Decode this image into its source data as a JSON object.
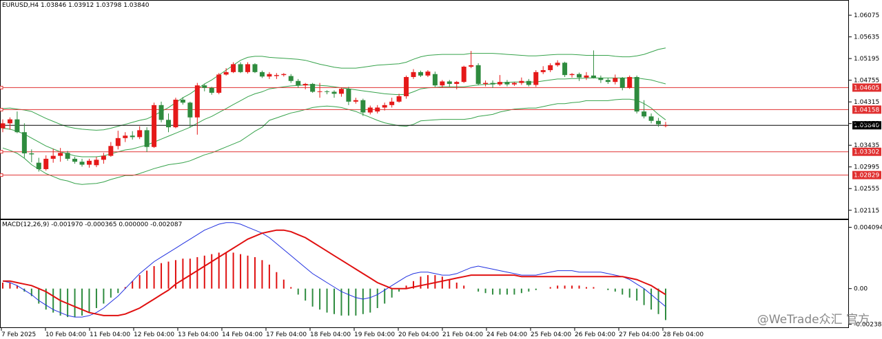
{
  "header": {
    "symbol_info": "EURUSD,H4  1.03846 1.03912 1.03798 1.03840",
    "macd_info": "MACD(12,26,9) -0.001970 -0.000365 0.000000 -0.002087"
  },
  "watermark": "@WeTrade众汇 官方",
  "colors": {
    "bull": "#e51919",
    "bear": "#2e8b3e",
    "band": "#35a24a",
    "level": "#e03030",
    "macd_signal": "#e01010",
    "macd_main": "#2030e0",
    "price_line": "#000000"
  },
  "chart_data": [
    {
      "type": "candlestick",
      "title": "EURUSD,H4",
      "y_axis_ticks": [
        "1.06075",
        "1.05635",
        "1.05195",
        "1.04755",
        "1.04315",
        "1.03875",
        "1.03435",
        "1.02995",
        "1.02555",
        "1.02115"
      ],
      "ylim": [
        1.02,
        1.063
      ],
      "x_axis_labels": [
        "7 Feb 2025",
        "10 Feb 04:00",
        "11 Feb 04:00",
        "12 Feb 04:00",
        "13 Feb 04:00",
        "14 Feb 04:00",
        "17 Feb 04:00",
        "18 Feb 04:00",
        "19 Feb 04:00",
        "20 Feb 04:00",
        "21 Feb 04:00",
        "24 Feb 04:00",
        "25 Feb 04:00",
        "26 Feb 04:00",
        "27 Feb 04:00",
        "28 Feb 04:00"
      ],
      "current_price": "1.03840",
      "levels": [
        {
          "label": "1.04605",
          "value": 1.04605
        },
        {
          "label": "1.04158",
          "value": 1.04158
        },
        {
          "label": "1.03302",
          "value": 1.03302
        },
        {
          "label": "1.02829",
          "value": 1.02829
        }
      ],
      "candles": [
        [
          1.0378,
          1.0396,
          1.037,
          1.0388
        ],
        [
          1.0388,
          1.04,
          1.0375,
          1.0396
        ],
        [
          1.0396,
          1.0412,
          1.0368,
          1.037
        ],
        [
          1.037,
          1.0388,
          1.0318,
          1.0327
        ],
        [
          1.0327,
          1.0335,
          1.0309,
          1.0325
        ],
        [
          1.0308,
          1.0318,
          1.029,
          1.0295
        ],
        [
          1.0295,
          1.0323,
          1.0292,
          1.0316
        ],
        [
          1.0316,
          1.0336,
          1.0308,
          1.0322
        ],
        [
          1.0322,
          1.0338,
          1.031,
          1.0328
        ],
        [
          1.0328,
          1.0332,
          1.0312,
          1.0316
        ],
        [
          1.0316,
          1.032,
          1.0306,
          1.031
        ],
        [
          1.031,
          1.0316,
          1.03,
          1.0304
        ],
        [
          1.0304,
          1.0316,
          1.0298,
          1.0312
        ],
        [
          1.0303,
          1.032,
          1.0299,
          1.0314
        ],
        [
          1.0314,
          1.0328,
          1.0306,
          1.0322
        ],
        [
          1.0322,
          1.035,
          1.032,
          1.0342
        ],
        [
          1.0342,
          1.0373,
          1.0335,
          1.0358
        ],
        [
          1.0358,
          1.037,
          1.035,
          1.0363
        ],
        [
          1.0363,
          1.0372,
          1.0355,
          1.036
        ],
        [
          1.036,
          1.0382,
          1.0356,
          1.0374
        ],
        [
          1.0374,
          1.038,
          1.033,
          1.034
        ],
        [
          1.034,
          1.043,
          1.0338,
          1.0425
        ],
        [
          1.0425,
          1.0432,
          1.039,
          1.0395
        ],
        [
          1.0395,
          1.0408,
          1.037,
          1.038
        ],
        [
          1.038,
          1.044,
          1.0378,
          1.0436
        ],
        [
          1.0436,
          1.0441,
          1.0426,
          1.043
        ],
        [
          1.043,
          1.0432,
          1.038,
          1.04
        ],
        [
          1.04,
          1.047,
          1.0365,
          1.0465
        ],
        [
          1.0465,
          1.0468,
          1.0453,
          1.046
        ],
        [
          1.046,
          1.0462,
          1.0446,
          1.045
        ],
        [
          1.045,
          1.049,
          1.0447,
          1.0487
        ],
        [
          1.0487,
          1.05,
          1.0485,
          1.0492
        ],
        [
          1.0492,
          1.0512,
          1.049,
          1.0508
        ],
        [
          1.0508,
          1.0512,
          1.049,
          1.0492
        ],
        [
          1.0492,
          1.0512,
          1.0489,
          1.0508
        ],
        [
          1.0508,
          1.051,
          1.049,
          1.0492
        ],
        [
          1.0492,
          1.0495,
          1.048,
          1.0483
        ],
        [
          1.0483,
          1.0492,
          1.0478,
          1.0488
        ],
        [
          1.0484,
          1.049,
          1.0478,
          1.0486
        ],
        [
          1.0486,
          1.049,
          1.0483,
          1.0488
        ],
        [
          1.0484,
          1.0488,
          1.047,
          1.0474
        ],
        [
          1.0474,
          1.0478,
          1.046,
          1.0465
        ],
        [
          1.0465,
          1.047,
          1.0457,
          1.0468
        ],
        [
          1.0468,
          1.047,
          1.045,
          1.0452
        ],
        [
          1.0452,
          1.047,
          1.044,
          1.0453
        ],
        [
          1.0453,
          1.0455,
          1.0447,
          1.0452
        ],
        [
          1.0452,
          1.0455,
          1.044,
          1.0448
        ],
        [
          1.0448,
          1.046,
          1.0442,
          1.0458
        ],
        [
          1.0458,
          1.0462,
          1.0425,
          1.0432
        ],
        [
          1.0432,
          1.044,
          1.0428,
          1.0435
        ],
        [
          1.0435,
          1.0438,
          1.0403,
          1.041
        ],
        [
          1.041,
          1.0424,
          1.0406,
          1.042
        ],
        [
          1.0412,
          1.0425,
          1.0408,
          1.042
        ],
        [
          1.042,
          1.043,
          1.0414,
          1.0425
        ],
        [
          1.0425,
          1.044,
          1.042,
          1.0432
        ],
        [
          1.0432,
          1.0448,
          1.043,
          1.0443
        ],
        [
          1.0443,
          1.0485,
          1.0438,
          1.0482
        ],
        [
          1.0482,
          1.0498,
          1.0478,
          1.0492
        ],
        [
          1.0492,
          1.0495,
          1.0482,
          1.0485
        ],
        [
          1.0485,
          1.0496,
          1.0482,
          1.0493
        ],
        [
          1.0488,
          1.0493,
          1.0462,
          1.0465
        ],
        [
          1.0465,
          1.0476,
          1.046,
          1.0473
        ],
        [
          1.0473,
          1.0476,
          1.0462,
          1.0468
        ],
        [
          1.0468,
          1.0474,
          1.0457,
          1.0472
        ],
        [
          1.0472,
          1.0505,
          1.047,
          1.0503
        ],
        [
          1.0503,
          1.0535,
          1.05,
          1.0506
        ],
        [
          1.0506,
          1.051,
          1.0465,
          1.0468
        ],
        [
          1.0468,
          1.0475,
          1.0463,
          1.047
        ],
        [
          1.047,
          1.0475,
          1.046,
          1.0467
        ],
        [
          1.0467,
          1.0486,
          1.0464,
          1.0472
        ],
        [
          1.0472,
          1.0476,
          1.0463,
          1.0467
        ],
        [
          1.0467,
          1.0472,
          1.0464,
          1.047
        ],
        [
          1.047,
          1.0481,
          1.0466,
          1.0474
        ],
        [
          1.0474,
          1.0478,
          1.0463,
          1.0466
        ],
        [
          1.0466,
          1.0496,
          1.0462,
          1.0492
        ],
        [
          1.0492,
          1.0504,
          1.0488,
          1.0496
        ],
        [
          1.0496,
          1.051,
          1.0492,
          1.0506
        ],
        [
          1.0506,
          1.0516,
          1.0503,
          1.0511
        ],
        [
          1.0511,
          1.0513,
          1.0482,
          1.0486
        ],
        [
          1.0486,
          1.049,
          1.0481,
          1.0488
        ],
        [
          1.0488,
          1.0491,
          1.0474,
          1.0481
        ],
        [
          1.0481,
          1.0492,
          1.0476,
          1.0485
        ],
        [
          1.0485,
          1.0536,
          1.0479,
          1.048
        ],
        [
          1.048,
          1.0485,
          1.047,
          1.0476
        ],
        [
          1.0476,
          1.048,
          1.0468,
          1.0472
        ],
        [
          1.0472,
          1.0487,
          1.0467,
          1.048
        ],
        [
          1.048,
          1.0482,
          1.0455,
          1.046
        ],
        [
          1.046,
          1.0485,
          1.0458,
          1.0482
        ],
        [
          1.0482,
          1.0485,
          1.0408,
          1.0412
        ],
        [
          1.0412,
          1.0435,
          1.0398,
          1.0402
        ],
        [
          1.0402,
          1.0408,
          1.0388,
          1.0393
        ],
        [
          1.0393,
          1.0399,
          1.0381,
          1.0386
        ],
        [
          1.0384,
          1.0391,
          1.038,
          1.0384
        ]
      ],
      "bollinger": {
        "upper": [
          1.0418,
          1.0419,
          1.0417,
          1.0415,
          1.0412,
          1.0405,
          1.0398,
          1.0392,
          1.0386,
          1.0381,
          1.0378,
          1.0376,
          1.0375,
          1.0374,
          1.0375,
          1.0378,
          1.0382,
          1.0386,
          1.039,
          1.0394,
          1.0397,
          1.0404,
          1.0412,
          1.042,
          1.043,
          1.044,
          1.0448,
          1.0458,
          1.0468,
          1.0476,
          1.0486,
          1.0496,
          1.0506,
          1.0516,
          1.0522,
          1.0524,
          1.0524,
          1.0522,
          1.0521,
          1.052,
          1.0519,
          1.0518,
          1.0516,
          1.0512,
          1.0508,
          1.0505,
          1.0502,
          1.05,
          1.05,
          1.05,
          1.0502,
          1.0504,
          1.0506,
          1.0507,
          1.0508,
          1.0509,
          1.0512,
          1.0518,
          1.0523,
          1.0526,
          1.0527,
          1.0528,
          1.0528,
          1.0528,
          1.0528,
          1.053,
          1.053,
          1.053,
          1.053,
          1.0529,
          1.0528,
          1.0527,
          1.0526,
          1.0525,
          1.0525,
          1.0526,
          1.0527,
          1.0528,
          1.0528,
          1.0528,
          1.0527,
          1.0526,
          1.0526,
          1.0526,
          1.0526,
          1.0524,
          1.0523,
          1.0523,
          1.0525,
          1.0528,
          1.0533,
          1.0538,
          1.0541
        ],
        "middle": [
          1.0378,
          1.0376,
          1.0372,
          1.0366,
          1.0358,
          1.035,
          1.0342,
          1.0336,
          1.033,
          1.0326,
          1.0322,
          1.032,
          1.032,
          1.032,
          1.0322,
          1.0326,
          1.033,
          1.0334,
          1.0336,
          1.034,
          1.0344,
          1.035,
          1.0356,
          1.0362,
          1.0368,
          1.0374,
          1.038,
          1.0388,
          1.0396,
          1.0402,
          1.041,
          1.0418,
          1.0426,
          1.0434,
          1.0442,
          1.0448,
          1.0452,
          1.0458,
          1.046,
          1.0462,
          1.0464,
          1.0465,
          1.0466,
          1.0466,
          1.0465,
          1.0464,
          1.0462,
          1.046,
          1.0458,
          1.0456,
          1.0454,
          1.0452,
          1.045,
          1.0448,
          1.0447,
          1.0446,
          1.0447,
          1.0452,
          1.0458,
          1.046,
          1.0461,
          1.0462,
          1.0462,
          1.0462,
          1.0462,
          1.0464,
          1.0466,
          1.0467,
          1.0468,
          1.047,
          1.0471,
          1.0472,
          1.0472,
          1.0472,
          1.0472,
          1.0474,
          1.0476,
          1.0478,
          1.0478,
          1.0479,
          1.0479,
          1.048,
          1.048,
          1.048,
          1.048,
          1.048,
          1.048,
          1.048,
          1.048,
          1.0478,
          1.0476,
          1.0472,
          1.0468
        ],
        "lower": [
          1.0338,
          1.0333,
          1.0327,
          1.0317,
          1.0304,
          1.0295,
          1.0286,
          1.028,
          1.0274,
          1.0271,
          1.0266,
          1.0264,
          1.0265,
          1.0266,
          1.0269,
          1.0274,
          1.0278,
          1.0282,
          1.0282,
          1.0286,
          1.0291,
          1.0296,
          1.03,
          1.0304,
          1.0306,
          1.0308,
          1.0312,
          1.0318,
          1.0324,
          1.0328,
          1.0334,
          1.034,
          1.0346,
          1.0352,
          1.0362,
          1.0372,
          1.038,
          1.0394,
          1.0399,
          1.0404,
          1.0409,
          1.0412,
          1.0416,
          1.042,
          1.0422,
          1.0423,
          1.0422,
          1.042,
          1.0416,
          1.0412,
          1.0406,
          1.04,
          1.0394,
          1.0389,
          1.0386,
          1.0383,
          1.0382,
          1.0386,
          1.0393,
          1.0394,
          1.0395,
          1.0396,
          1.0396,
          1.0396,
          1.0396,
          1.0398,
          1.0402,
          1.0404,
          1.0406,
          1.0411,
          1.0414,
          1.0417,
          1.0418,
          1.0419,
          1.0419,
          1.0422,
          1.0425,
          1.0428,
          1.0428,
          1.043,
          1.0431,
          1.0434,
          1.0434,
          1.0434,
          1.0434,
          1.0436,
          1.0437,
          1.0437,
          1.0435,
          1.0428,
          1.0419,
          1.0406,
          1.0395
        ]
      }
    },
    {
      "type": "macd",
      "title": "MACD(12,26,9)",
      "y_axis_ticks": [
        "0.004094",
        "0.00",
        "-0.002382"
      ],
      "ylim": [
        -0.0024,
        0.0043
      ],
      "histogram": [
        0.0004,
        0.0004,
        0.0002,
        -0.0002,
        -0.0005,
        -0.001,
        -0.0014,
        -0.0016,
        -0.0018,
        -0.0019,
        -0.0019,
        -0.0018,
        -0.0016,
        -0.0013,
        -0.001,
        -0.0006,
        -0.0003,
        0.0001,
        0.0005,
        0.0009,
        0.0012,
        0.0015,
        0.0017,
        0.0018,
        0.0019,
        0.002,
        0.002,
        0.0021,
        0.0022,
        0.0023,
        0.0024,
        0.0024,
        0.0024,
        0.0023,
        0.0022,
        0.0021,
        0.0019,
        0.0016,
        0.0011,
        0.0006,
        0.0001,
        -0.0004,
        -0.0008,
        -0.0012,
        -0.0014,
        -0.0016,
        -0.0017,
        -0.0018,
        -0.0018,
        -0.0018,
        -0.0017,
        -0.0016,
        -0.0013,
        -0.001,
        -0.0006,
        -0.0002,
        0.0002,
        0.0005,
        0.0008,
        0.0009,
        0.0009,
        0.0008,
        0.0006,
        0.0004,
        0.0002,
        0.0,
        -0.0002,
        -0.0003,
        -0.0004,
        -0.0004,
        -0.0004,
        -0.0004,
        -0.0003,
        -0.0002,
        -0.0001,
        0.0,
        0.0001,
        0.0002,
        0.0002,
        0.0002,
        0.0002,
        0.0001,
        0.0001,
        0.0,
        -0.0001,
        -0.0002,
        -0.0004,
        -0.0006,
        -0.0008,
        -0.0011,
        -0.0014,
        -0.0017,
        -0.0021
      ],
      "main_line": [
        0.0005,
        0.0004,
        0.0002,
        -0.0001,
        -0.0004,
        -0.0008,
        -0.0011,
        -0.0014,
        -0.0016,
        -0.0018,
        -0.0019,
        -0.0019,
        -0.0018,
        -0.0016,
        -0.0013,
        -0.0009,
        -0.0005,
        0.0,
        0.0005,
        0.001,
        0.0014,
        0.0018,
        0.0021,
        0.0024,
        0.0027,
        0.003,
        0.0033,
        0.0036,
        0.0039,
        0.0041,
        0.0043,
        0.0044,
        0.0044,
        0.0043,
        0.0041,
        0.0039,
        0.0037,
        0.0034,
        0.003,
        0.0026,
        0.0022,
        0.0018,
        0.0014,
        0.001,
        0.0007,
        0.0004,
        0.0001,
        -0.0002,
        -0.0004,
        -0.0006,
        -0.0007,
        -0.0006,
        -0.0004,
        -0.0001,
        0.0002,
        0.0005,
        0.0008,
        0.001,
        0.0011,
        0.0011,
        0.001,
        0.0009,
        0.0009,
        0.001,
        0.0012,
        0.0014,
        0.0015,
        0.0014,
        0.0013,
        0.0012,
        0.0011,
        0.001,
        0.0009,
        0.0009,
        0.0009,
        0.001,
        0.0011,
        0.0012,
        0.0012,
        0.0012,
        0.0011,
        0.0011,
        0.0011,
        0.0011,
        0.001,
        0.0009,
        0.0008,
        0.0006,
        0.0003,
        0.0,
        -0.0004,
        -0.0008,
        -0.0012
      ],
      "signal_line": [
        0.0005,
        0.0005,
        0.0004,
        0.0003,
        0.0002,
        0.0,
        -0.0002,
        -0.0005,
        -0.0008,
        -0.001,
        -0.0012,
        -0.0014,
        -0.0016,
        -0.0017,
        -0.0018,
        -0.0018,
        -0.0018,
        -0.0017,
        -0.0015,
        -0.0013,
        -0.001,
        -0.0007,
        -0.0004,
        -0.0001,
        0.0003,
        0.0006,
        0.0009,
        0.0012,
        0.0015,
        0.0018,
        0.0021,
        0.0024,
        0.0027,
        0.003,
        0.0033,
        0.0035,
        0.0037,
        0.0038,
        0.0039,
        0.0039,
        0.0038,
        0.0036,
        0.0034,
        0.0031,
        0.0028,
        0.0025,
        0.0022,
        0.0019,
        0.0016,
        0.0013,
        0.001,
        0.0007,
        0.0004,
        0.0002,
        0.0,
        0.0,
        0.0,
        0.0001,
        0.0002,
        0.0003,
        0.0004,
        0.0005,
        0.0006,
        0.0007,
        0.0008,
        0.0009,
        0.0009,
        0.0009,
        0.0009,
        0.0009,
        0.0009,
        0.0009,
        0.0008,
        0.0008,
        0.0008,
        0.0008,
        0.0008,
        0.0008,
        0.0008,
        0.0008,
        0.0008,
        0.0008,
        0.0008,
        0.0008,
        0.0008,
        0.0008,
        0.0008,
        0.0007,
        0.0006,
        0.0004,
        0.0002,
        -0.0001,
        -0.0004
      ]
    }
  ]
}
